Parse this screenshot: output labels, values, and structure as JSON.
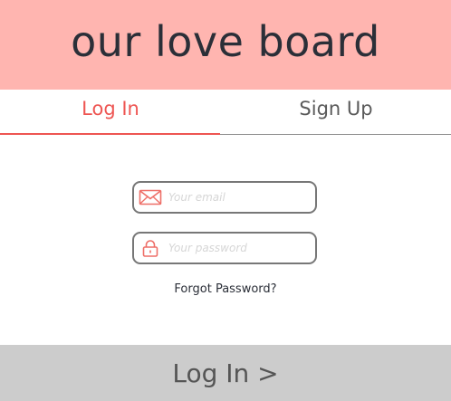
{
  "header": {
    "title": "our love board"
  },
  "tabs": [
    {
      "label": "Log In",
      "active": true
    },
    {
      "label": "Sign Up",
      "active": false
    }
  ],
  "login_form": {
    "email": {
      "placeholder": "Your email",
      "value": "",
      "icon": "envelope-icon"
    },
    "password": {
      "placeholder": "Your password",
      "value": "",
      "icon": "lock-icon"
    },
    "forgot_link": "Forgot Password?",
    "submit_label": "Log In >"
  },
  "colors": {
    "header_bg": "#ffb5b0",
    "accent": "#ee5552",
    "submit_bg": "#cccccc",
    "text_dark": "#2b2f38"
  }
}
